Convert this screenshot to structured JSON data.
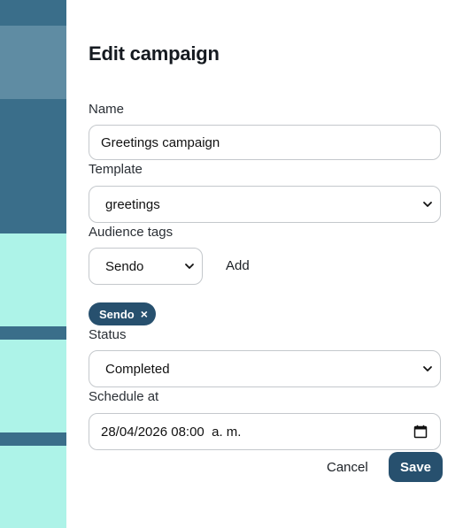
{
  "drawer": {
    "title": "Edit campaign"
  },
  "form": {
    "name": {
      "label": "Name",
      "value": "Greetings campaign"
    },
    "template": {
      "label": "Template",
      "selected": "greetings"
    },
    "audience_tags": {
      "label": "Audience tags",
      "selected": "Sendo",
      "add_label": "Add",
      "chips": [
        {
          "label": "Sendo",
          "remove_glyph": "×"
        }
      ]
    },
    "status": {
      "label": "Status",
      "selected": "Completed"
    },
    "schedule": {
      "label": "Schedule at",
      "value": "28/04/2026 08:00  a. m."
    }
  },
  "actions": {
    "cancel_label": "Cancel",
    "save_label": "Save"
  },
  "colors": {
    "primary": "#27506e",
    "background_accent": "#adf3e8",
    "background_dark": "#3a6e8a"
  },
  "icons": {
    "select_chevron": "chevron-down-icon",
    "date_picker": "calendar-icon",
    "chip_remove": "close-icon"
  }
}
